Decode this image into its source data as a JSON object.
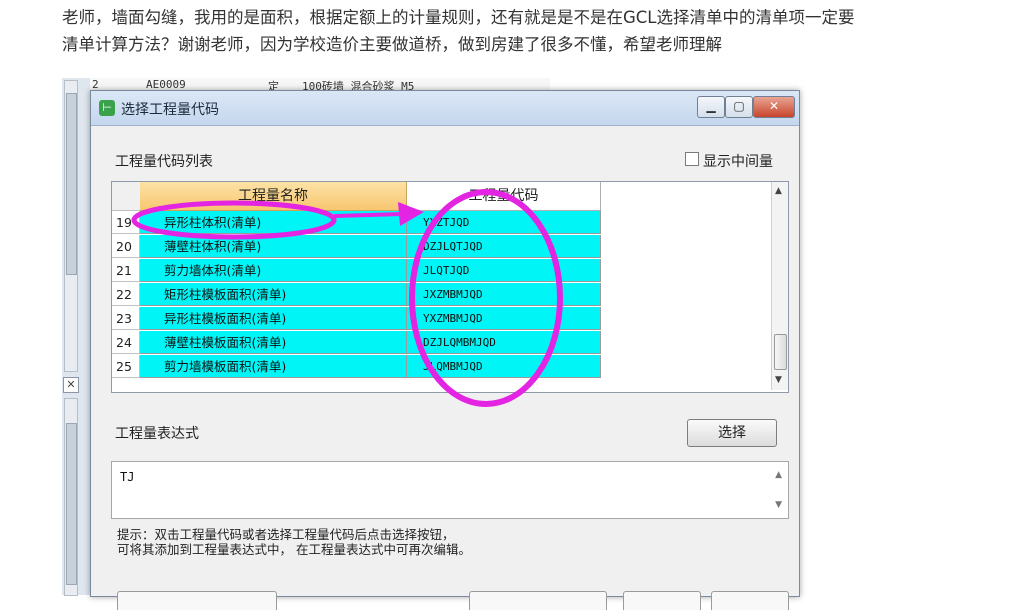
{
  "question": {
    "line1": "老师，墙面勾缝，我用的是面积，根据定额上的计量规则，还有就是是不是在GCL选择清单中的清单项一定要",
    "line2": "清单计算方法？谢谢老师，因为学校造价主要做道桥，做到房建了很多不懂，希望老师理解"
  },
  "background_row": {
    "num": "2",
    "code": "AE0009",
    "type": "定",
    "desc": "100砖墙 混合砂浆 M5"
  },
  "dialog": {
    "title": "选择工程量代码",
    "list_label": "工程量代码列表",
    "show_intermediate_label": "显示中间量",
    "show_intermediate_checked": false,
    "columns": {
      "name": "工程量名称",
      "code": "工程量代码"
    },
    "rows": [
      {
        "num": "19",
        "name": "异形柱体积(清单)",
        "code": "YXZTJQD"
      },
      {
        "num": "20",
        "name": "薄壁柱体积(清单)",
        "code": "DZJLQTJQD"
      },
      {
        "num": "21",
        "name": "剪力墙体积(清单)",
        "code": "JLQTJQD"
      },
      {
        "num": "22",
        "name": "矩形柱模板面积(清单)",
        "code": "JXZMBMJQD"
      },
      {
        "num": "23",
        "name": "异形柱模板面积(清单)",
        "code": "YXZMBMJQD"
      },
      {
        "num": "24",
        "name": "薄壁柱模板面积(清单)",
        "code": "DZJLQMBMJQD"
      },
      {
        "num": "25",
        "name": "剪力墙模板面积(清单)",
        "code": "JLQMBMJQD"
      }
    ],
    "expression_label": "工程量表达式",
    "select_button": "选择",
    "expression_value": "TJ",
    "hint_line1": "提示：双击工程量代码或者选择工程量代码后点击选择按钮，",
    "hint_line2": "可将其添加到工程量表达式中， 在工程量表达式中可再次编辑。"
  },
  "colors": {
    "highlight_cyan": "#00f6f6",
    "header_orange": "#f7c770",
    "annotation_magenta": "#e324e3"
  }
}
